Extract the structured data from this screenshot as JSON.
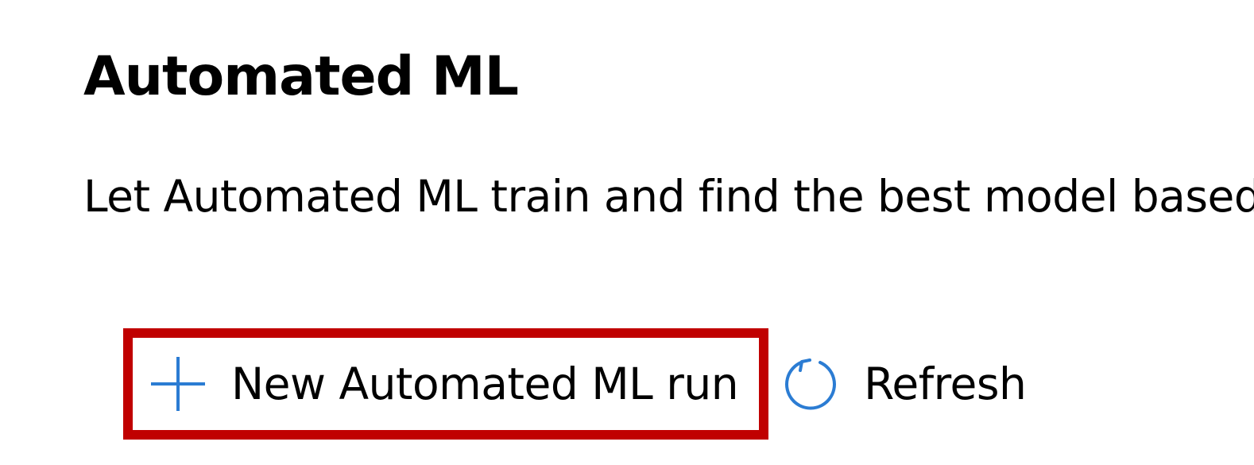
{
  "header": {
    "title": "Automated ML",
    "description": "Let Automated ML train and find the best model based"
  },
  "toolbar": {
    "new_run": {
      "label": "New Automated ML run",
      "icon": "plus-icon"
    },
    "refresh": {
      "label": "Refresh",
      "icon": "refresh-icon"
    }
  },
  "colors": {
    "accent": "#2b7cd3",
    "highlight_border": "#c00000",
    "text": "#000000",
    "background": "#ffffff"
  }
}
